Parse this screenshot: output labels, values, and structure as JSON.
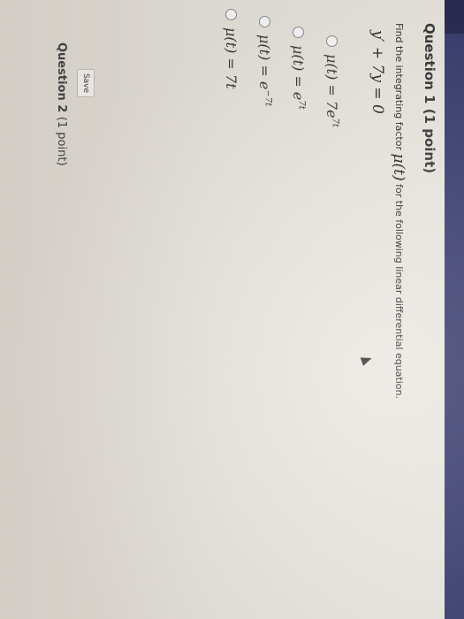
{
  "question1": {
    "title": "Question 1",
    "points": "(1 point)",
    "prompt_before": "Find the integrating factor",
    "prompt_mu": "μ(t)",
    "prompt_after": "for the following linear differential equation.",
    "equation": "y′ + 7y = 0",
    "options": [
      {
        "base": "μ(t) = 7e",
        "sup": "7t"
      },
      {
        "base": "μ(t) = e",
        "sup": "7t"
      },
      {
        "base": "μ(t) = e",
        "sup": "−7t"
      },
      {
        "base": "μ(t) = 7t",
        "sup": ""
      }
    ],
    "save_label": "Save"
  },
  "question2": {
    "title": "Question 2",
    "points": "(1 point)"
  },
  "colors": {
    "topbar": "#3c3f70",
    "page_bg": "#ede9e3"
  },
  "icons": [
    "radio-icon",
    "mouse-cursor-icon"
  ]
}
